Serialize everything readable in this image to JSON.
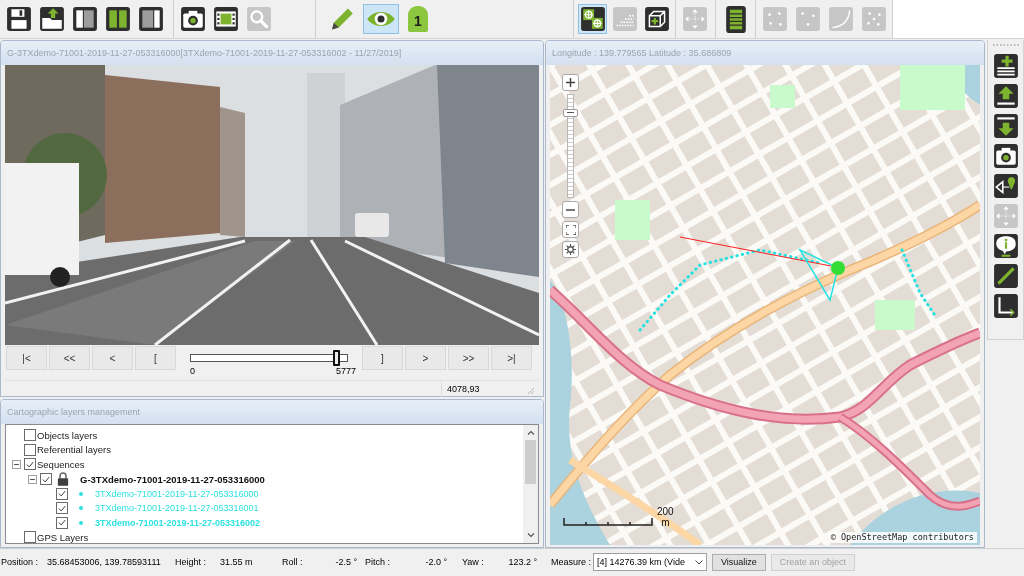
{
  "toolbar": {
    "groups": [
      {
        "items": [
          {
            "selected": false,
            "disabled": false
          },
          {
            "selected": false,
            "disabled": false
          },
          {
            "selected": false,
            "disabled": false
          },
          {
            "selected": false,
            "disabled": false
          },
          {
            "selected": false,
            "disabled": false
          }
        ]
      },
      {
        "items": [
          {
            "selected": false,
            "disabled": false
          },
          {
            "selected": false,
            "disabled": false
          },
          {
            "selected": false,
            "disabled": true
          }
        ]
      },
      {
        "items": [
          {
            "selected": false,
            "disabled": false
          },
          {
            "selected": true,
            "disabled": false
          },
          {
            "label": "1",
            "selected": false,
            "disabled": false
          }
        ]
      },
      {
        "items": [
          {
            "selected": true,
            "disabled": false
          },
          {
            "selected": false,
            "disabled": true
          },
          {
            "selected": false,
            "disabled": false
          }
        ]
      },
      {
        "items": [
          {
            "selected": false,
            "disabled": true
          }
        ]
      },
      {
        "items": [
          {
            "selected": false,
            "disabled": false
          }
        ]
      },
      {
        "items": [
          {
            "selected": false,
            "disabled": true
          },
          {
            "selected": false,
            "disabled": true
          },
          {
            "selected": false,
            "disabled": true
          },
          {
            "selected": false,
            "disabled": true
          }
        ]
      }
    ]
  },
  "video_panel": {
    "title": "G-3TXdemo-71001-2019-11-27-053316000[3TXdemo-71001-2019-11-27-053316002 - 11/27/2019]",
    "buttons_before_slider": [
      "|<",
      "<<",
      "<",
      "["
    ],
    "slider": {
      "level": 0.93,
      "min_label": "0",
      "max_label": "5777"
    },
    "buttons_after_slider": [
      "]",
      ">",
      ">>",
      ">|"
    ],
    "position_readout": "4078,93"
  },
  "layers_panel": {
    "title": "Cartographic layers management",
    "tree": [
      {
        "label": "Objects layers",
        "checked": false,
        "active": false
      },
      {
        "label": "Referential layers",
        "checked": false,
        "active": false
      },
      {
        "label": "Sequences",
        "checked": true,
        "active": false,
        "expanded": true,
        "children": [
          {
            "label": "G-3TXdemo-71001-2019-11-27-053316000",
            "checked": true,
            "active": true,
            "locked": true,
            "expanded": true,
            "children": [
              {
                "label": "3TXdemo-71001-2019-11-27-053316000",
                "checked": true,
                "active": false,
                "color": "#2ee0e0"
              },
              {
                "label": "3TXdemo-71001-2019-11-27-053316001",
                "checked": true,
                "active": false,
                "color": "#2ee0e0"
              },
              {
                "label": "3TXdemo-71001-2019-11-27-053316002",
                "checked": true,
                "active": true,
                "color": "#2ee0e0"
              }
            ]
          }
        ]
      },
      {
        "label": "GPS Layers",
        "checked": false,
        "active": false
      }
    ]
  },
  "map_panel": {
    "title": "Longitude : 139.779565 Latitude : 35.686809",
    "zoom_slider": {
      "level": 0.82
    },
    "scale": {
      "value": "200",
      "unit": "m"
    },
    "attribution": "© OpenStreetMap contributors"
  },
  "right_toolbar": [
    {
      "disabled": false
    },
    {
      "disabled": false
    },
    {
      "disabled": false
    },
    {
      "disabled": false
    },
    {
      "disabled": false
    },
    {
      "disabled": true
    },
    {
      "disabled": false
    },
    {
      "disabled": false
    },
    {
      "disabled": false
    }
  ],
  "status_bar": {
    "fields": [
      {
        "label": "Position :",
        "value": "35.68453006, 139.78593111"
      },
      {
        "label": "Height :",
        "value": "31.55 m"
      },
      {
        "label": "Roll :",
        "value": "-2.5 °"
      },
      {
        "label": "Pitch :",
        "value": "-2.0 °"
      },
      {
        "label": "Yaw :",
        "value": "123.2 °"
      }
    ],
    "measure": {
      "label": "Measure :",
      "value": "[4] 14276.39 km (Vide"
    },
    "buttons": [
      {
        "label": "Visualize",
        "disabled": false
      },
      {
        "label": "Create an object",
        "disabled": true
      }
    ]
  }
}
